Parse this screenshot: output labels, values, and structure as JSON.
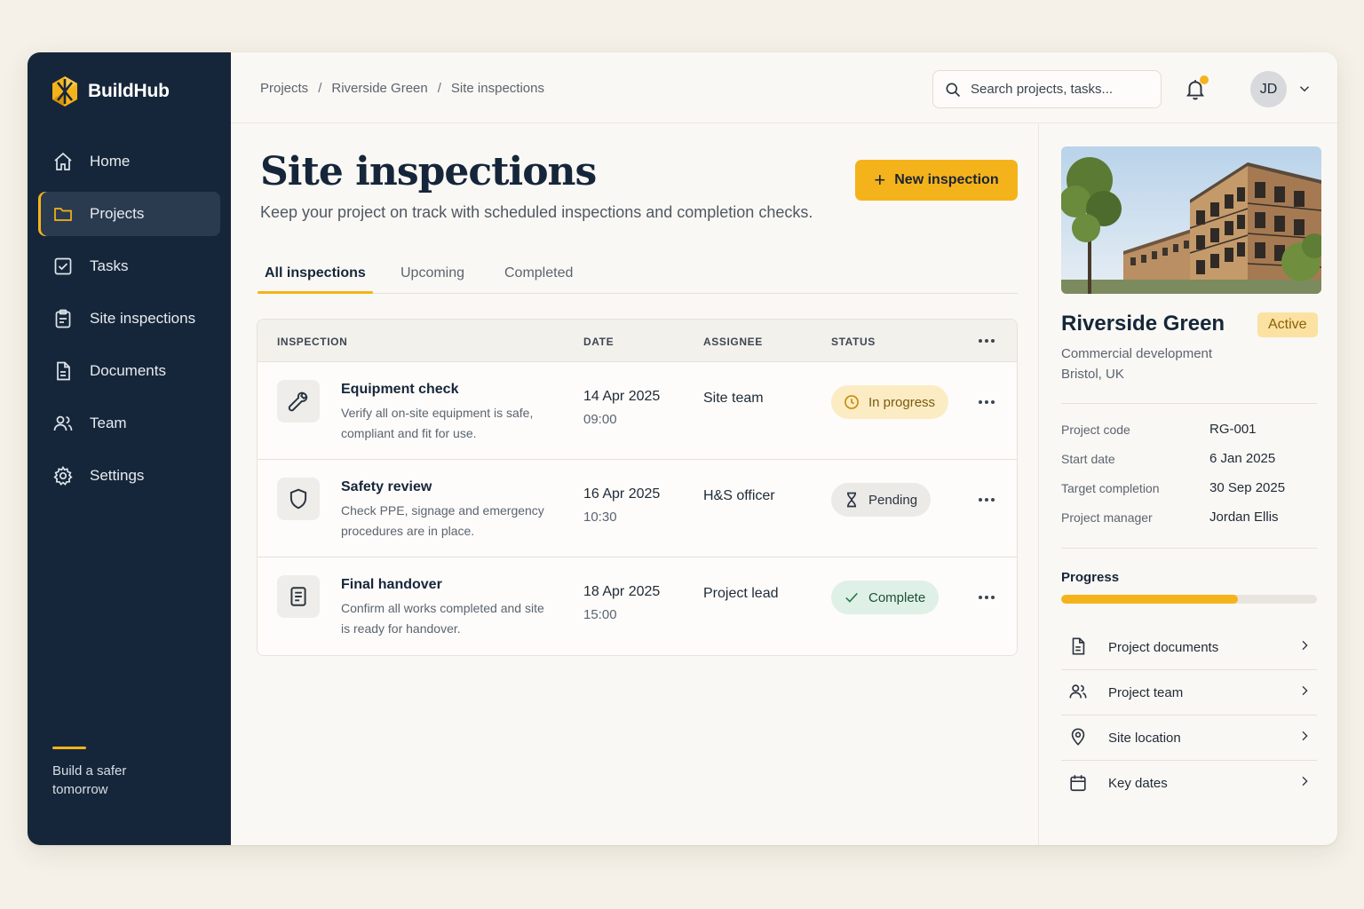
{
  "brand": {
    "name": "BuildHub"
  },
  "sidebar": {
    "items": [
      {
        "label": "Home",
        "icon": "home-icon"
      },
      {
        "label": "Projects",
        "icon": "folder-icon",
        "active": true
      },
      {
        "label": "Tasks",
        "icon": "checkbox-icon"
      },
      {
        "label": "Site inspections",
        "icon": "clipboard-icon"
      },
      {
        "label": "Documents",
        "icon": "document-icon"
      },
      {
        "label": "Team",
        "icon": "users-icon"
      },
      {
        "label": "Settings",
        "icon": "gear-icon"
      }
    ],
    "footer_text": "Build a safer tomorrow"
  },
  "breadcrumb": {
    "items": [
      "Projects",
      "Riverside Green",
      "Site inspections"
    ],
    "separator": "/"
  },
  "search": {
    "placeholder": "Search projects, tasks..."
  },
  "user": {
    "initials": "JD"
  },
  "page": {
    "title": "Site inspections",
    "subtitle": "Keep your project on track with scheduled inspections and completion checks.",
    "new_button_label": "New inspection"
  },
  "tabs": [
    {
      "label": "All inspections",
      "active": true
    },
    {
      "label": "Upcoming"
    },
    {
      "label": "Completed"
    }
  ],
  "table": {
    "headers": {
      "inspection": "INSPECTION",
      "date": "DATE",
      "assignee": "ASSIGNEE",
      "status": "STATUS"
    },
    "rows": [
      {
        "icon": "wrench-icon",
        "title": "Equipment check",
        "description": "Verify all on-site equipment is safe, compliant and fit for use.",
        "date": "14 Apr 2025",
        "time": "09:00",
        "assignee": "Site team",
        "status": "In progress",
        "status_kind": "progress",
        "status_icon": "clock-icon"
      },
      {
        "icon": "shield-icon",
        "title": "Safety review",
        "description": "Check PPE, signage and emergency procedures are in place.",
        "date": "16 Apr 2025",
        "time": "10:30",
        "assignee": "H&S officer",
        "status": "Pending",
        "status_kind": "pending",
        "status_icon": "hourglass-icon"
      },
      {
        "icon": "document-icon",
        "title": "Final handover",
        "description": "Confirm all works completed and site is ready for handover.",
        "date": "18 Apr 2025",
        "time": "15:00",
        "assignee": "Project lead",
        "status": "Complete",
        "status_kind": "complete",
        "status_icon": "check-icon"
      }
    ]
  },
  "project": {
    "name": "Riverside Green",
    "status": "Active",
    "type": "Commercial development",
    "location": "Bristol, UK",
    "details": [
      {
        "label": "Project code",
        "value": "RG-001"
      },
      {
        "label": "Start date",
        "value": "6 Jan 2025"
      },
      {
        "label": "Target completion",
        "value": "30 Sep 2025"
      },
      {
        "label": "Project manager",
        "value": "Jordan Ellis"
      }
    ],
    "progress_label": "Progress",
    "progress_fraction": 0.69,
    "links": [
      {
        "label": "Project documents",
        "icon": "document-icon"
      },
      {
        "label": "Project team",
        "icon": "users-icon"
      },
      {
        "label": "Site location",
        "icon": "location-pin-icon"
      },
      {
        "label": "Key dates",
        "icon": "calendar-icon"
      }
    ]
  },
  "colors": {
    "accent": "#f5b31b",
    "sidebar_bg": "#16263a",
    "page_bg": "#faf8f4"
  }
}
